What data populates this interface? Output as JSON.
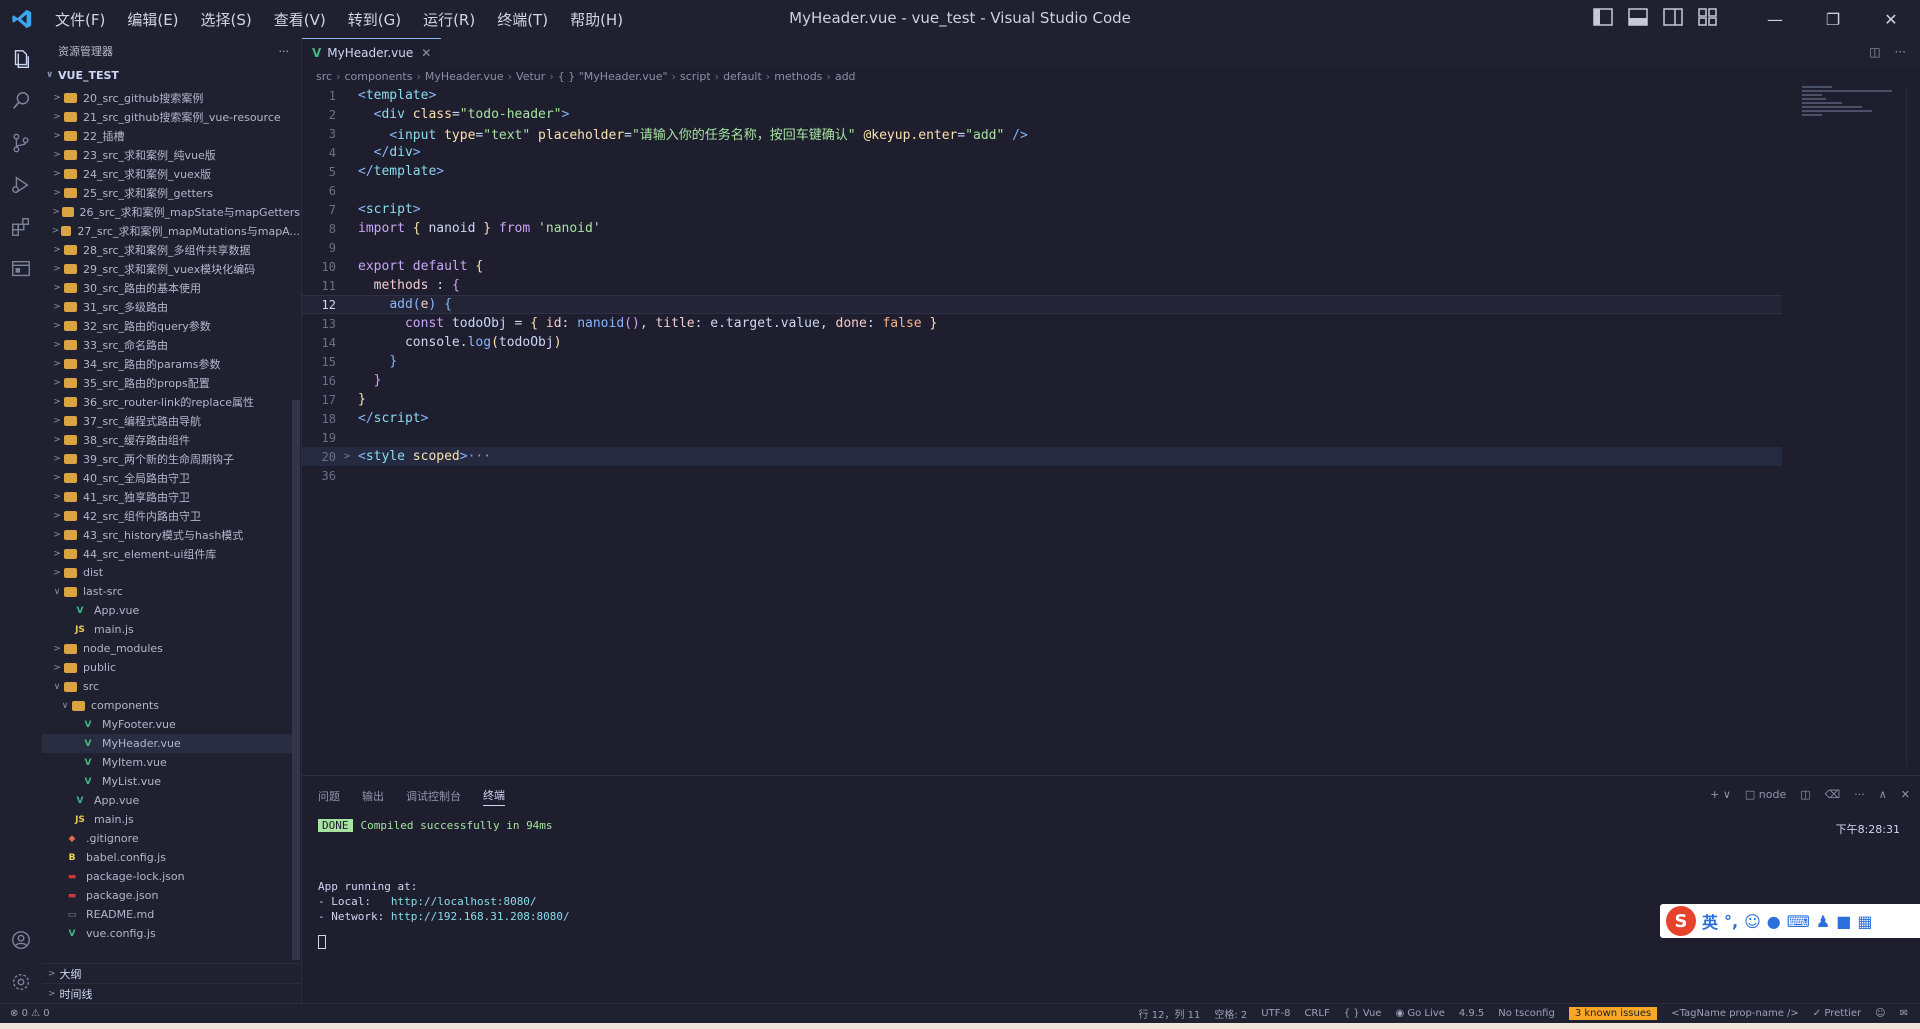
{
  "window": {
    "title": "MyHeader.vue - vue_test - Visual Studio Code",
    "menu": [
      "文件(F)",
      "编辑(E)",
      "选择(S)",
      "查看(V)",
      "转到(G)",
      "运行(R)",
      "终端(T)",
      "帮助(H)"
    ]
  },
  "sidebar": {
    "title": "资源管理器",
    "project": "VUE_TEST",
    "items": [
      {
        "label": "20_src_github搜索案例",
        "type": "folder",
        "depth": 1
      },
      {
        "label": "21_src_github搜索案例_vue-resource",
        "type": "folder",
        "depth": 1
      },
      {
        "label": "22_插槽",
        "type": "folder",
        "depth": 1
      },
      {
        "label": "23_src_求和案例_纯vue版",
        "type": "folder",
        "depth": 1
      },
      {
        "label": "24_src_求和案例_vuex版",
        "type": "folder",
        "depth": 1
      },
      {
        "label": "25_src_求和案例_getters",
        "type": "folder",
        "depth": 1
      },
      {
        "label": "26_src_求和案例_mapState与mapGetters",
        "type": "folder",
        "depth": 1
      },
      {
        "label": "27_src_求和案例_mapMutations与mapA...",
        "type": "folder",
        "depth": 1
      },
      {
        "label": "28_src_求和案例_多组件共享数据",
        "type": "folder",
        "depth": 1
      },
      {
        "label": "29_src_求和案例_vuex模块化编码",
        "type": "folder",
        "depth": 1
      },
      {
        "label": "30_src_路由的基本使用",
        "type": "folder",
        "depth": 1
      },
      {
        "label": "31_src_多级路由",
        "type": "folder",
        "depth": 1
      },
      {
        "label": "32_src_路由的query参数",
        "type": "folder",
        "depth": 1
      },
      {
        "label": "33_src_命名路由",
        "type": "folder",
        "depth": 1
      },
      {
        "label": "34_src_路由的params参数",
        "type": "folder",
        "depth": 1
      },
      {
        "label": "35_src_路由的props配置",
        "type": "folder",
        "depth": 1
      },
      {
        "label": "36_src_router-link的replace属性",
        "type": "folder",
        "depth": 1
      },
      {
        "label": "37_src_编程式路由导航",
        "type": "folder",
        "depth": 1
      },
      {
        "label": "38_src_缓存路由组件",
        "type": "folder",
        "depth": 1
      },
      {
        "label": "39_src_两个新的生命周期钩子",
        "type": "folder",
        "depth": 1
      },
      {
        "label": "40_src_全局路由守卫",
        "type": "folder",
        "depth": 1
      },
      {
        "label": "41_src_独享路由守卫",
        "type": "folder",
        "depth": 1
      },
      {
        "label": "42_src_组件内路由守卫",
        "type": "folder",
        "depth": 1
      },
      {
        "label": "43_src_history模式与hash模式",
        "type": "folder",
        "depth": 1
      },
      {
        "label": "44_src_element-ui组件库",
        "type": "folder",
        "depth": 1
      },
      {
        "label": "dist",
        "type": "folder",
        "depth": 1
      },
      {
        "label": "last-src",
        "type": "folder-open",
        "depth": 1
      },
      {
        "label": "App.vue",
        "type": "vue",
        "depth": 2
      },
      {
        "label": "main.js",
        "type": "js",
        "depth": 2
      },
      {
        "label": "node_modules",
        "type": "folder",
        "depth": 1
      },
      {
        "label": "public",
        "type": "folder",
        "depth": 1
      },
      {
        "label": "src",
        "type": "folder-open",
        "depth": 1
      },
      {
        "label": "components",
        "type": "folder-open",
        "depth": 2
      },
      {
        "label": "MyFooter.vue",
        "type": "vue",
        "depth": 3
      },
      {
        "label": "MyHeader.vue",
        "type": "vue",
        "depth": 3,
        "active": true
      },
      {
        "label": "MyItem.vue",
        "type": "vue",
        "depth": 3
      },
      {
        "label": "MyList.vue",
        "type": "vue",
        "depth": 3
      },
      {
        "label": "App.vue",
        "type": "vue",
        "depth": 2
      },
      {
        "label": "main.js",
        "type": "js",
        "depth": 2
      },
      {
        "label": ".gitignore",
        "type": "git",
        "depth": 1
      },
      {
        "label": "babel.config.js",
        "type": "babel",
        "depth": 1
      },
      {
        "label": "package-lock.json",
        "type": "npm",
        "depth": 1
      },
      {
        "label": "package.json",
        "type": "npm",
        "depth": 1
      },
      {
        "label": "README.md",
        "type": "md",
        "depth": 1
      },
      {
        "label": "vue.config.js",
        "type": "vue",
        "depth": 1
      }
    ],
    "outline": "大纲",
    "timeline": "时间线"
  },
  "editor": {
    "tab": "MyHeader.vue",
    "breadcrumb": [
      "src",
      "components",
      "MyHeader.vue",
      "Vetur",
      "{ } \"MyHeader.vue\"",
      "script",
      "default",
      "methods",
      "add"
    ],
    "lines": [
      {
        "n": "1",
        "tokens": [
          [
            "t-tag",
            "<"
          ],
          [
            "t-tagname",
            "template"
          ],
          [
            "t-tag",
            ">"
          ]
        ]
      },
      {
        "n": "2",
        "tokens": [
          [
            "",
            "  "
          ],
          [
            "t-tag",
            "<"
          ],
          [
            "t-tagname",
            "div "
          ],
          [
            "t-attr",
            "class"
          ],
          [
            "",
            "="
          ],
          [
            "t-str",
            "\"todo-header\""
          ],
          [
            "t-tag",
            ">"
          ]
        ]
      },
      {
        "n": "3",
        "tokens": [
          [
            "",
            "    "
          ],
          [
            "t-tag",
            "<"
          ],
          [
            "t-tagname",
            "input "
          ],
          [
            "t-attr",
            "type"
          ],
          [
            "",
            "="
          ],
          [
            "t-str",
            "\"text\" "
          ],
          [
            "t-attr",
            "placeholder"
          ],
          [
            "",
            "="
          ],
          [
            "t-str",
            "\"请输入你的任务名称，按回车键确认\" "
          ],
          [
            "t-attr",
            "@keyup.enter"
          ],
          [
            "",
            "="
          ],
          [
            "t-str",
            "\"add\" "
          ],
          [
            "t-tag",
            "/>"
          ]
        ]
      },
      {
        "n": "4",
        "tokens": [
          [
            "",
            "  "
          ],
          [
            "t-tag",
            "</"
          ],
          [
            "t-tagname",
            "div"
          ],
          [
            "t-tag",
            ">"
          ]
        ]
      },
      {
        "n": "5",
        "tokens": [
          [
            "t-tag",
            "</"
          ],
          [
            "t-tagname",
            "template"
          ],
          [
            "t-tag",
            ">"
          ]
        ]
      },
      {
        "n": "6",
        "tokens": []
      },
      {
        "n": "7",
        "tokens": [
          [
            "t-tag",
            "<"
          ],
          [
            "t-tagname",
            "script"
          ],
          [
            "t-tag",
            ">"
          ]
        ]
      },
      {
        "n": "8",
        "tokens": [
          [
            "t-kw",
            "import "
          ],
          [
            "t-br1",
            "{ "
          ],
          [
            "",
            "nanoid "
          ],
          [
            "t-br1",
            "} "
          ],
          [
            "t-kw",
            "from "
          ],
          [
            "t-str",
            "'nanoid'"
          ]
        ]
      },
      {
        "n": "9",
        "tokens": []
      },
      {
        "n": "10",
        "tokens": [
          [
            "t-kw",
            "export default "
          ],
          [
            "t-br1",
            "{"
          ]
        ]
      },
      {
        "n": "11",
        "tokens": [
          [
            "",
            "  "
          ],
          [
            "t-prop",
            "methods"
          ],
          [
            "",
            " : "
          ],
          [
            "t-br2",
            "{"
          ]
        ]
      },
      {
        "n": "12",
        "tokens": [
          [
            "",
            "    "
          ],
          [
            "t-fn",
            "add"
          ],
          [
            "t-br3",
            "("
          ],
          [
            "t-prop",
            "e"
          ],
          [
            "t-br3",
            ")"
          ],
          [
            "",
            " "
          ],
          [
            "t-br3",
            "{"
          ]
        ],
        "current": true
      },
      {
        "n": "13",
        "tokens": [
          [
            "",
            "      "
          ],
          [
            "t-kw",
            "const "
          ],
          [
            "",
            "todoObj = "
          ],
          [
            "t-br1",
            "{ "
          ],
          [
            "t-prop",
            "id"
          ],
          [
            "",
            ": "
          ],
          [
            "t-fn",
            "nanoid"
          ],
          [
            "t-br2",
            "()"
          ],
          [
            "",
            ", "
          ],
          [
            "t-prop",
            "title"
          ],
          [
            "",
            ": e.target.value, "
          ],
          [
            "t-prop",
            "done"
          ],
          [
            "",
            ": "
          ],
          [
            "t-bool",
            "false "
          ],
          [
            "t-br1",
            "}"
          ]
        ]
      },
      {
        "n": "14",
        "tokens": [
          [
            "",
            "      console."
          ],
          [
            "t-fn",
            "log"
          ],
          [
            "t-br1",
            "("
          ],
          [
            "",
            "todoObj"
          ],
          [
            "t-br1",
            ")"
          ]
        ]
      },
      {
        "n": "15",
        "tokens": [
          [
            "",
            "    "
          ],
          [
            "t-br3",
            "}"
          ]
        ]
      },
      {
        "n": "16",
        "tokens": [
          [
            "",
            "  "
          ],
          [
            "t-br2",
            "}"
          ]
        ]
      },
      {
        "n": "17",
        "tokens": [
          [
            "t-br1",
            "}"
          ]
        ]
      },
      {
        "n": "18",
        "tokens": [
          [
            "t-tag",
            "</"
          ],
          [
            "t-tagname",
            "script"
          ],
          [
            "t-tag",
            ">"
          ]
        ]
      },
      {
        "n": "19",
        "tokens": []
      },
      {
        "n": "20",
        "tokens": [
          [
            "t-tag",
            "<"
          ],
          [
            "t-tagname",
            "style "
          ],
          [
            "t-attr",
            "scoped"
          ],
          [
            "t-tag",
            ">"
          ],
          [
            "t-ell",
            "···"
          ]
        ],
        "folded": true,
        "highlight": true
      },
      {
        "n": "36",
        "tokens": []
      }
    ]
  },
  "panel": {
    "tabs": [
      "问题",
      "输出",
      "调试控制台",
      "终端"
    ],
    "active_tab": "终端",
    "terminal_shell": "node",
    "done_badge": "DONE",
    "compiled": "Compiled successfully in 94ms",
    "time": "下午8:28:31",
    "running": "App running at:",
    "local_label": "- Local:   ",
    "local_url": "http://localhost:8080/",
    "network_label": "- Network: ",
    "network_url": "http://192.168.31.208:8080/",
    "ime_lang": "英"
  },
  "statusbar": {
    "errors": "0",
    "warnings": "0",
    "position": "行 12，列 11",
    "spaces": "空格: 2",
    "encoding": "UTF-8",
    "eol": "CRLF",
    "language": "Vue",
    "golive": "Go Live",
    "version": "4.9.5",
    "tsconfig": "No tsconfig",
    "issues": "3 known issues",
    "tagname": "<TagName prop-name />",
    "prettier": "Prettier"
  }
}
